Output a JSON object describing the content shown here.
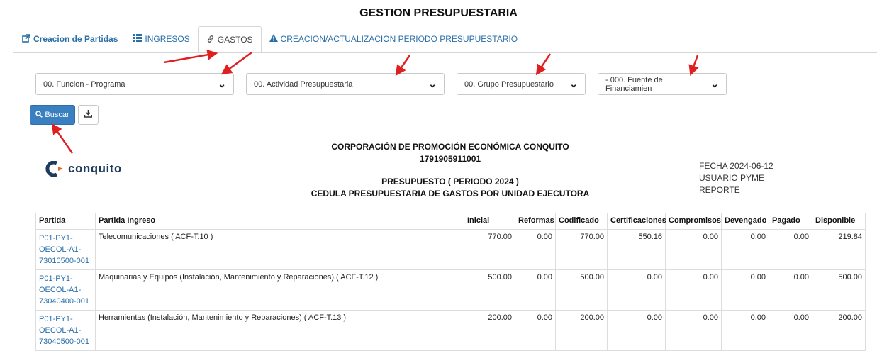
{
  "page": {
    "title": "GESTION PRESUPUESTARIA"
  },
  "tabs": [
    {
      "label": "Creacion de Partidas",
      "icon": "external-link-icon"
    },
    {
      "label": "INGRESOS",
      "icon": "list-icon"
    },
    {
      "label": "GASTOS",
      "icon": "link-icon"
    },
    {
      "label": "CREACION/ACTUALIZACION PERIODO PRESUPUESTARIO",
      "icon": "warning-icon"
    }
  ],
  "filters": {
    "funcion": "00. Funcion - Programa",
    "actividad": "00. Actividad Presupuestaria",
    "grupo": "00. Grupo Presupuestario",
    "fuente": "- 000. Fuente de Financiamien"
  },
  "actions": {
    "buscar": "Buscar"
  },
  "report": {
    "org": "CORPORACIÓN DE PROMOCIÓN ECONÓMICA CONQUITO",
    "ruc": "1791905911001",
    "presupuesto": "PRESUPUESTO ( PERIODO 2024 )",
    "cedula": "CEDULA PRESUPUESTARIA DE GASTOS POR UNIDAD EJECUTORA",
    "logo_text": "conquito",
    "fecha": "FECHA 2024-06-12",
    "usuario": "USUARIO PYME",
    "reporte": "REPORTE"
  },
  "table": {
    "headers": [
      "Partida",
      "Partida Ingreso",
      "Inicial",
      "Reformas",
      "Codificado",
      "Certificaciones",
      "Compromisos",
      "Devengado",
      "Pagado",
      "Disponible"
    ],
    "rows": [
      {
        "code": [
          "P01-PY1-",
          "OECOL-A1-",
          "73010500-001"
        ],
        "desc": "Telecomunicaciones ( ACF-T.10 )",
        "vals": [
          "770.00",
          "0.00",
          "770.00",
          "550.16",
          "0.00",
          "0.00",
          "0.00",
          "219.84"
        ]
      },
      {
        "code": [
          "P01-PY1-",
          "OECOL-A1-",
          "73040400-001"
        ],
        "desc": "Maquinarias y Equipos (Instalación, Mantenimiento y Reparaciones) ( ACF-T.12 )",
        "vals": [
          "500.00",
          "0.00",
          "500.00",
          "0.00",
          "0.00",
          "0.00",
          "0.00",
          "500.00"
        ]
      },
      {
        "code": [
          "P01-PY1-",
          "OECOL-A1-",
          "73040500-001"
        ],
        "desc": "Herramientas (Instalación, Mantenimiento y Reparaciones) ( ACF-T.13 )",
        "vals": [
          "200.00",
          "0.00",
          "200.00",
          "0.00",
          "0.00",
          "0.00",
          "0.00",
          "200.00"
        ]
      }
    ]
  },
  "colors": {
    "link": "#2a6fa8",
    "primary": "#3a7fc0",
    "arrow": "#e02020"
  }
}
